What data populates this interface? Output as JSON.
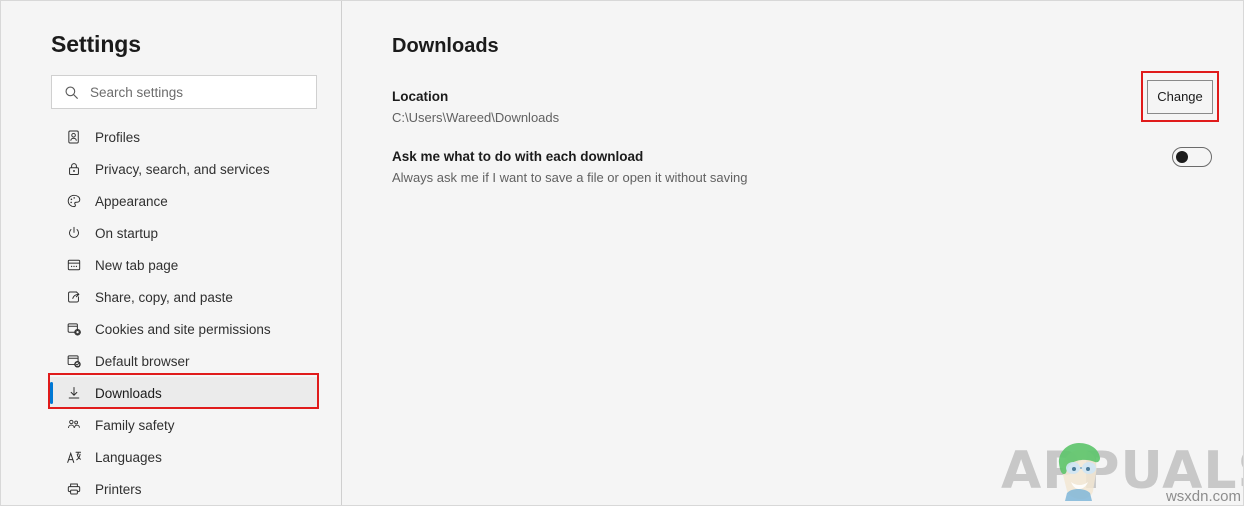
{
  "sidebar": {
    "title": "Settings",
    "search": {
      "placeholder": "Search settings",
      "value": "",
      "icon": "search-icon"
    },
    "items": [
      {
        "label": "Profiles",
        "icon": "profiles-icon",
        "selected": false
      },
      {
        "label": "Privacy, search, and services",
        "icon": "lock-icon",
        "selected": false
      },
      {
        "label": "Appearance",
        "icon": "palette-icon",
        "selected": false
      },
      {
        "label": "On startup",
        "icon": "power-icon",
        "selected": false
      },
      {
        "label": "New tab page",
        "icon": "new-tab-icon",
        "selected": false
      },
      {
        "label": "Share, copy, and paste",
        "icon": "share-icon",
        "selected": false
      },
      {
        "label": "Cookies and site permissions",
        "icon": "cookies-icon",
        "selected": false
      },
      {
        "label": "Default browser",
        "icon": "default-browser-icon",
        "selected": false
      },
      {
        "label": "Downloads",
        "icon": "download-icon",
        "selected": true
      },
      {
        "label": "Family safety",
        "icon": "family-icon",
        "selected": false
      },
      {
        "label": "Languages",
        "icon": "languages-icon",
        "selected": false
      },
      {
        "label": "Printers",
        "icon": "printer-icon",
        "selected": false
      }
    ]
  },
  "main": {
    "page_title": "Downloads",
    "location": {
      "title": "Location",
      "value": "C:\\Users\\Wareed\\Downloads",
      "button_label": "Change"
    },
    "ask_each_download": {
      "title": "Ask me what to do with each download",
      "description": "Always ask me if I want to save a file or open it without saving",
      "toggle_state": "off"
    }
  },
  "annotations": {
    "highlight_color": "#e01b1b",
    "accent_color": "#0078d4",
    "boxes": [
      {
        "name": "downloads-sidebar-item"
      },
      {
        "name": "change-button"
      }
    ]
  },
  "watermark": {
    "brand": "APPUALS",
    "domain": "wsxdn.com"
  }
}
